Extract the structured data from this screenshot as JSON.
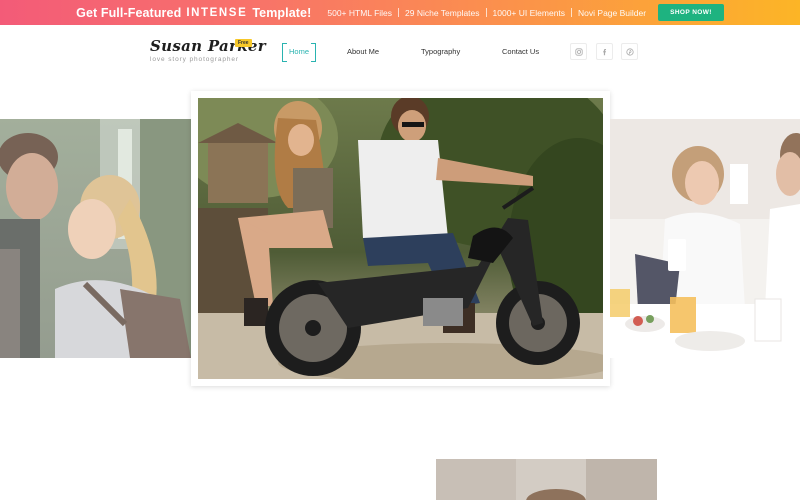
{
  "promo": {
    "headline_prefix": "Get Full-Featured",
    "brand": "INTENSE",
    "headline_suffix": "Template!",
    "features": [
      "500+ HTML Files",
      "29 Niche Templates",
      "1000+ UI Elements",
      "Novi Page Builder"
    ],
    "cta_label": "SHOP NOW!"
  },
  "header": {
    "logo": {
      "name": "Susan Parker",
      "badge": "Free",
      "tagline": "love story photographer"
    },
    "nav": [
      {
        "label": "Home",
        "active": true
      },
      {
        "label": "About Me",
        "active": false
      },
      {
        "label": "Typography",
        "active": false
      },
      {
        "label": "Contact Us",
        "active": false
      }
    ],
    "social": [
      "instagram-icon",
      "facebook-icon",
      "pinterest-icon"
    ]
  },
  "colors": {
    "accent": "#29b3b0",
    "cta": "#1eb380",
    "banner_gradient": [
      "#f35b78",
      "#fb8e4f",
      "#fcb526"
    ],
    "badge": "#f7c82a"
  },
  "slider": {
    "slides": [
      "couple-in-forest-photo",
      "couple-on-motorcycle-photo",
      "couple-at-breakfast-photo"
    ]
  }
}
